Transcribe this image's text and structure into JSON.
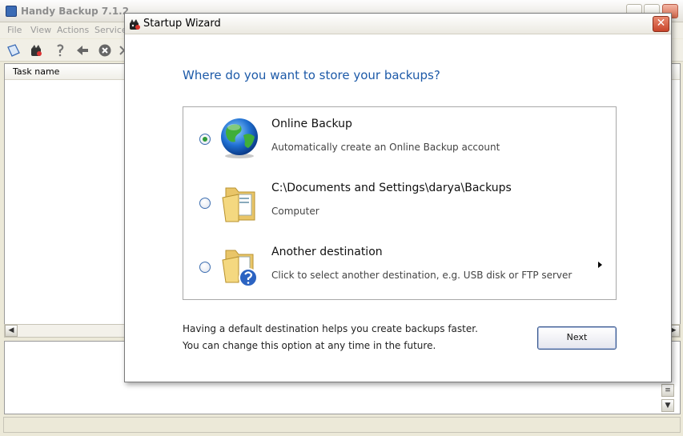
{
  "app": {
    "title": "Handy Backup 7.1.2",
    "menu": [
      "File",
      "View",
      "Actions",
      "Service"
    ],
    "task_column_header": "Task name"
  },
  "dialog": {
    "title": "Startup Wizard",
    "close_glyph": "✕",
    "heading": "Where do you want to store your backups?",
    "options": [
      {
        "title": "Online Backup",
        "subtitle": "Automatically create an Online Backup account",
        "icon": "globe-icon",
        "selected": true
      },
      {
        "title": "C:\\Documents and Settings\\darya\\Backups",
        "subtitle": "Computer",
        "icon": "folder-icon",
        "selected": false
      },
      {
        "title": "Another destination",
        "subtitle": "Click to select another destination, e.g. USB disk or FTP server",
        "icon": "folder-question-icon",
        "selected": false
      }
    ],
    "footer_line1": "Having a default destination helps you create backups faster.",
    "footer_line2": "You can change this option at any time in the future.",
    "next_label": "Next"
  },
  "colors": {
    "heading": "#1d5aa8",
    "radio_selected": "#2e9b3a",
    "close_button": "#c8442a"
  }
}
